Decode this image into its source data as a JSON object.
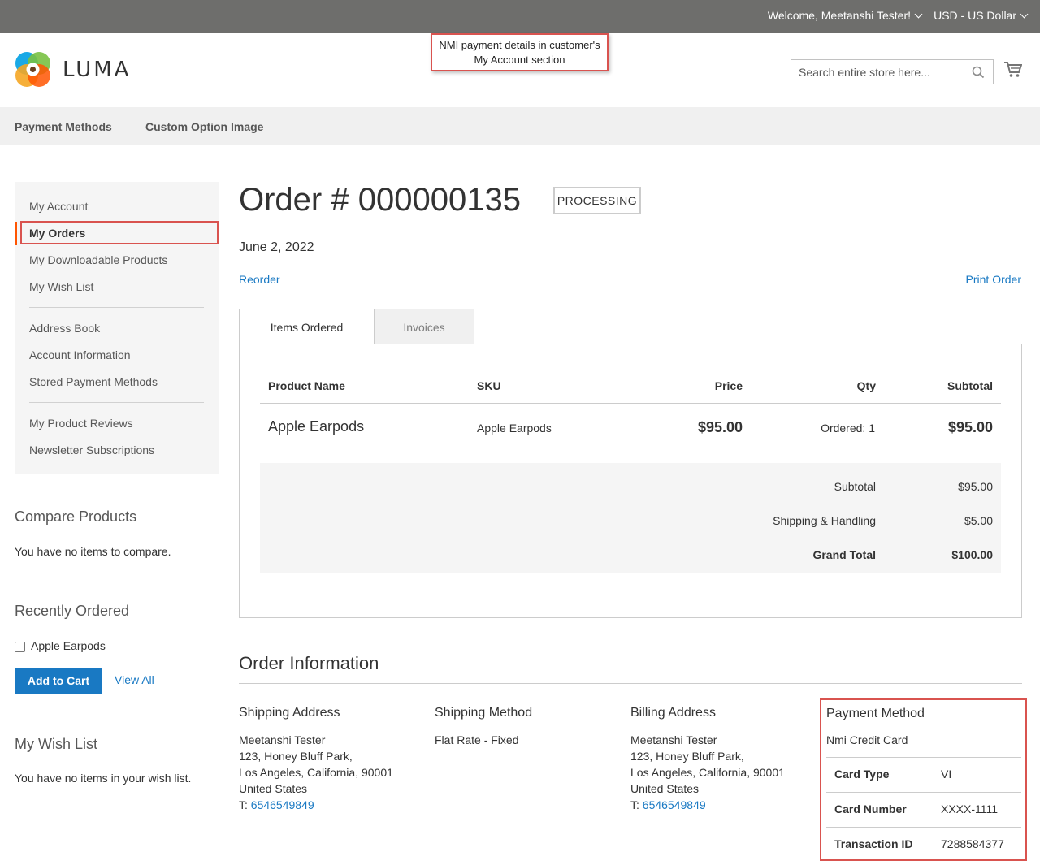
{
  "header": {
    "welcome": "Welcome, Meetanshi Tester!",
    "currency": "USD - US Dollar",
    "logo_text": "LUMA",
    "callout": "NMI payment details in customer's My Account section",
    "search_placeholder": "Search entire store here..."
  },
  "nav": {
    "items": [
      "Payment Methods",
      "Custom Option Image"
    ]
  },
  "sidebar": {
    "account_nav": [
      "My Account",
      "My Orders",
      "My Downloadable Products",
      "My Wish List",
      "Address Book",
      "Account Information",
      "Stored Payment Methods",
      "My Product Reviews",
      "Newsletter Subscriptions"
    ],
    "active_item": "My Orders",
    "compare": {
      "title": "Compare Products",
      "text": "You have no items to compare."
    },
    "recently_ordered": {
      "title": "Recently Ordered",
      "item": "Apple Earpods",
      "add_to_cart": "Add to Cart",
      "view_all": "View All"
    },
    "wishlist": {
      "title": "My Wish List",
      "text": "You have no items in your wish list."
    }
  },
  "order": {
    "title": "Order # 000000135",
    "status": "PROCESSING",
    "date": "June 2, 2022",
    "reorder": "Reorder",
    "print": "Print Order",
    "tabs": [
      "Items Ordered",
      "Invoices"
    ],
    "columns": [
      "Product Name",
      "SKU",
      "Price",
      "Qty",
      "Subtotal"
    ],
    "items": [
      {
        "name": "Apple Earpods",
        "sku": "Apple Earpods",
        "price": "$95.00",
        "qty": "Ordered: 1",
        "subtotal": "$95.00"
      }
    ],
    "totals": [
      {
        "label": "Subtotal",
        "value": "$95.00"
      },
      {
        "label": "Shipping & Handling",
        "value": "$5.00"
      },
      {
        "label": "Grand Total",
        "value": "$100.00"
      }
    ]
  },
  "order_info": {
    "title": "Order Information",
    "shipping_address": {
      "title": "Shipping Address",
      "name": "Meetanshi Tester",
      "street": "123, Honey Bluff Park,",
      "city": "Los Angeles, California, 90001",
      "country": "United States",
      "phone_prefix": "T:",
      "phone": "6546549849"
    },
    "shipping_method": {
      "title": "Shipping Method",
      "value": "Flat Rate - Fixed"
    },
    "billing_address": {
      "title": "Billing Address",
      "name": "Meetanshi Tester",
      "street": "123, Honey Bluff Park,",
      "city": "Los Angeles, California, 90001",
      "country": "United States",
      "phone_prefix": "T:",
      "phone": "6546549849"
    },
    "payment_method": {
      "title": "Payment Method",
      "name": "Nmi Credit Card",
      "rows": [
        {
          "label": "Card Type",
          "value": "VI"
        },
        {
          "label": "Card Number",
          "value": "XXXX-1111"
        },
        {
          "label": "Transaction ID",
          "value": "7288584377"
        }
      ]
    }
  },
  "colors": {
    "link": "#1979c3",
    "accent": "#ff5501",
    "highlight": "#d9534f",
    "topbar": "#6e6e6c"
  }
}
